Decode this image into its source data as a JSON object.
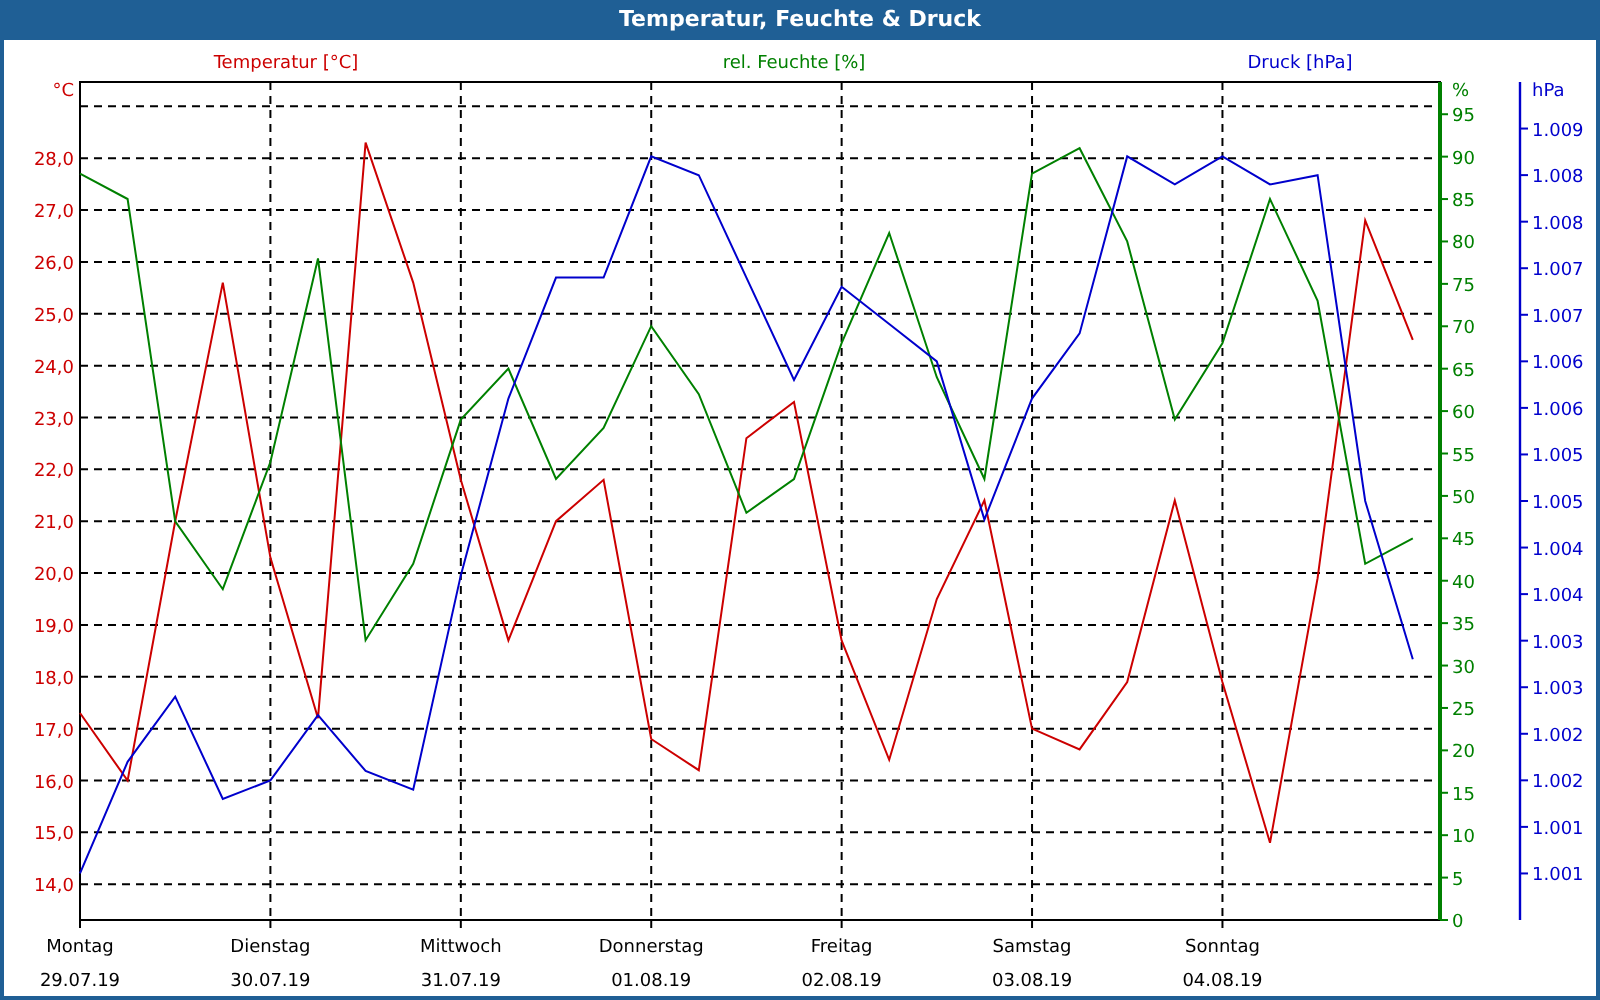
{
  "window": {
    "title": "Temperatur, Feuchte & Druck"
  },
  "charts": [
    {
      "chart_data": {
        "type": "line",
        "grid": true,
        "title": "Temperatur [°C]",
        "ylabel": "°C",
        "ylim": [
          13.31,
          29.47
        ],
        "categories": [
          "Montag",
          null,
          null,
          null,
          "Dienstag",
          null,
          null,
          null,
          "Mittwoch",
          null,
          null,
          null,
          "Donnerstag",
          null,
          null,
          null,
          "Freitag",
          null,
          null,
          null,
          "Samstag",
          null,
          null,
          null,
          "Sonntag",
          null,
          null,
          null,
          null
        ],
        "yticks": [
          {
            "value": 28,
            "label": "28,0"
          },
          {
            "value": 27,
            "label": "27,0"
          },
          {
            "value": 26,
            "label": "26,0"
          },
          {
            "value": 25,
            "label": "25,0"
          },
          {
            "value": 24,
            "label": "24,0"
          },
          {
            "value": 23,
            "label": "23,0"
          },
          {
            "value": 22,
            "label": "22,0"
          },
          {
            "value": 21,
            "label": "21,0"
          },
          {
            "value": 20,
            "label": "20,0"
          },
          {
            "value": 19,
            "label": "19,0"
          },
          {
            "value": 18,
            "label": "18,0"
          },
          {
            "value": 17,
            "label": "17,0"
          },
          {
            "value": 16,
            "label": "16,0"
          },
          {
            "value": 15,
            "label": "15,0"
          },
          {
            "value": 14,
            "label": "14,0"
          }
        ],
        "series": [
          {
            "color": "#cc0000",
            "values": [
              17.3,
              16.0,
              21.0,
              25.6,
              20.3,
              17.2,
              28.3,
              25.6,
              21.8,
              18.7,
              21.0,
              21.8,
              16.8,
              16.2,
              22.6,
              23.3,
              18.7,
              16.4,
              19.5,
              21.4,
              17.0,
              16.6,
              17.9,
              21.4,
              17.9,
              14.8,
              19.9,
              26.8,
              24.5
            ]
          }
        ]
      }
    },
    {
      "chart_data": {
        "type": "line",
        "title": "rel. Feuchte [%]",
        "ylabel": "%",
        "ylim": [
          0,
          98.8
        ],
        "categories": [
          null,
          null,
          null,
          null,
          null,
          null,
          null,
          null,
          null,
          null,
          null,
          null,
          null,
          null,
          null,
          null,
          null,
          null,
          null,
          null,
          null,
          null,
          null,
          null,
          null,
          null,
          null,
          null,
          null
        ],
        "yticks": [
          {
            "value": 95,
            "label": "95"
          },
          {
            "value": 90,
            "label": "90"
          },
          {
            "value": 85,
            "label": "85"
          },
          {
            "value": 80,
            "label": "80"
          },
          {
            "value": 75,
            "label": "75"
          },
          {
            "value": 70,
            "label": "70"
          },
          {
            "value": 65,
            "label": "65"
          },
          {
            "value": 60,
            "label": "60"
          },
          {
            "value": 55,
            "label": "55"
          },
          {
            "value": 50,
            "label": "50"
          },
          {
            "value": 45,
            "label": "45"
          },
          {
            "value": 40,
            "label": "40"
          },
          {
            "value": 35,
            "label": "35"
          },
          {
            "value": 30,
            "label": "30"
          },
          {
            "value": 25,
            "label": "25"
          },
          {
            "value": 20,
            "label": "20"
          },
          {
            "value": 15,
            "label": "15"
          },
          {
            "value": 10,
            "label": "10"
          },
          {
            "value": 5,
            "label": "5"
          },
          {
            "value": 0,
            "label": "0"
          }
        ],
        "series": [
          {
            "color": "#008000",
            "values": [
              88,
              85,
              47,
              39,
              54,
              78,
              33,
              42,
              59,
              65,
              52,
              58,
              70,
              62,
              48,
              52,
              68,
              81,
              64,
              52,
              88,
              91,
              80,
              59,
              68,
              85,
              73,
              42,
              45
            ]
          }
        ]
      }
    },
    {
      "chart_data": {
        "type": "line",
        "title": "Druck [hPa]",
        "ylabel": "hPa",
        "ylim": [
          1000.5,
          1009.5
        ],
        "categories": [
          null,
          null,
          null,
          null,
          null,
          null,
          null,
          null,
          null,
          null,
          null,
          null,
          null,
          null,
          null,
          null,
          null,
          null,
          null,
          null,
          null,
          null,
          null,
          null,
          null,
          null,
          null,
          null,
          null
        ],
        "yticks": [
          {
            "value": 1009,
            "label": "1.009"
          },
          {
            "value": 1008.5,
            "label": "1.008"
          },
          {
            "value": 1008,
            "label": "1.008"
          },
          {
            "value": 1007.5,
            "label": "1.007"
          },
          {
            "value": 1007,
            "label": "1.007"
          },
          {
            "value": 1006.5,
            "label": "1.006"
          },
          {
            "value": 1006,
            "label": "1.006"
          },
          {
            "value": 1005.5,
            "label": "1.005"
          },
          {
            "value": 1005,
            "label": "1.005"
          },
          {
            "value": 1004.5,
            "label": "1.004"
          },
          {
            "value": 1004,
            "label": "1.004"
          },
          {
            "value": 1003.5,
            "label": "1.003"
          },
          {
            "value": 1003,
            "label": "1.003"
          },
          {
            "value": 1002.5,
            "label": "1.002"
          },
          {
            "value": 1002,
            "label": "1.002"
          },
          {
            "value": 1001.5,
            "label": "1.001"
          },
          {
            "value": 1001,
            "label": "1.001"
          }
        ],
        "series": [
          {
            "color": "#0000cc",
            "values": [
              1001.0,
              1002.2,
              1002.9,
              1001.8,
              1002.0,
              1002.7,
              1002.1,
              1001.9,
              1004.2,
              1006.1,
              1007.4,
              1007.4,
              1008.7,
              1008.5,
              1007.4,
              1006.3,
              1007.3,
              1006.9,
              1006.5,
              1004.8,
              1006.1,
              1006.8,
              1008.7,
              1008.4,
              1008.7,
              1008.4,
              1008.5,
              1005.0,
              1003.3
            ]
          }
        ]
      }
    }
  ],
  "date_labels": [
    "29.07.19",
    "30.07.19",
    "31.07.19",
    "01.08.19",
    "02.08.19",
    "03.08.19",
    "04.08.19"
  ]
}
